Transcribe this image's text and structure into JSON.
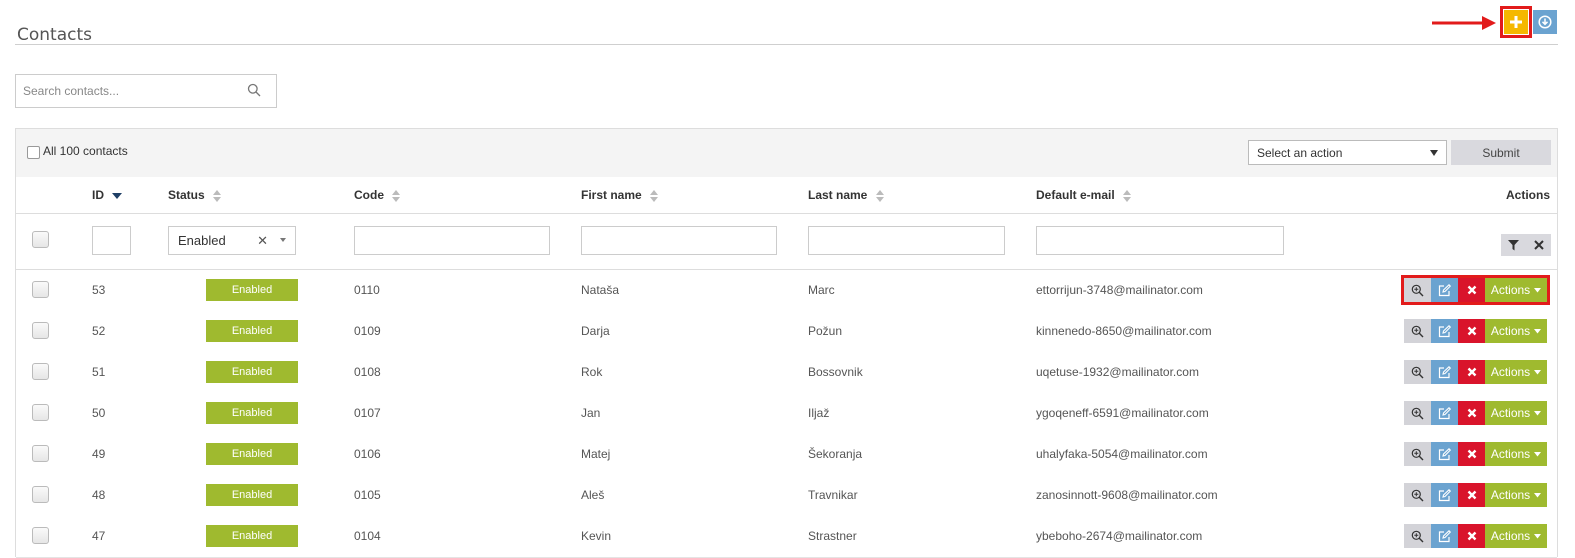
{
  "page": {
    "title": "Contacts"
  },
  "search": {
    "placeholder": "Search contacts..."
  },
  "toolbar": {
    "all_label": "All 100 contacts",
    "action_select": "Select an action",
    "submit_label": "Submit"
  },
  "columns": {
    "id": "ID",
    "status": "Status",
    "code": "Code",
    "first_name": "First name",
    "last_name": "Last name",
    "email": "Default e-mail",
    "actions": "Actions"
  },
  "filters": {
    "status_value": "Enabled"
  },
  "rows": [
    {
      "id": "53",
      "status": "Enabled",
      "code": "0110",
      "first_name": "Nataša",
      "last_name": "Marc",
      "email": "ettorrijun-3748@mailinator.com",
      "actions_label": "Actions"
    },
    {
      "id": "52",
      "status": "Enabled",
      "code": "0109",
      "first_name": "Darja",
      "last_name": "Požun",
      "email": "kinnenedo-8650@mailinator.com",
      "actions_label": "Actions"
    },
    {
      "id": "51",
      "status": "Enabled",
      "code": "0108",
      "first_name": "Rok",
      "last_name": "Bossovnik",
      "email": "uqetuse-1932@mailinator.com",
      "actions_label": "Actions"
    },
    {
      "id": "50",
      "status": "Enabled",
      "code": "0107",
      "first_name": "Jan",
      "last_name": "Iljaž",
      "email": "ygoqeneff-6591@mailinator.com",
      "actions_label": "Actions"
    },
    {
      "id": "49",
      "status": "Enabled",
      "code": "0106",
      "first_name": "Matej",
      "last_name": "Šekoranja",
      "email": "uhalyfaka-5054@mailinator.com",
      "actions_label": "Actions"
    },
    {
      "id": "48",
      "status": "Enabled",
      "code": "0105",
      "first_name": "Aleš",
      "last_name": "Travnikar",
      "email": "zanosinnott-9608@mailinator.com",
      "actions_label": "Actions"
    },
    {
      "id": "47",
      "status": "Enabled",
      "code": "0104",
      "first_name": "Kevin",
      "last_name": "Strastner",
      "email": "ybeboho-2674@mailinator.com",
      "actions_label": "Actions"
    }
  ],
  "icons": {
    "add": "plus-icon",
    "export": "download-icon",
    "search": "search-icon",
    "view": "zoom-icon",
    "edit": "edit-icon",
    "delete": "delete-icon",
    "filter": "filter-icon",
    "clear": "close-icon"
  },
  "colors": {
    "add_button": "#f5b800",
    "export_button": "#6ba3d0",
    "status_badge": "#9fba2f",
    "delete_button": "#d9142b",
    "annotation": "#e21b1b"
  }
}
